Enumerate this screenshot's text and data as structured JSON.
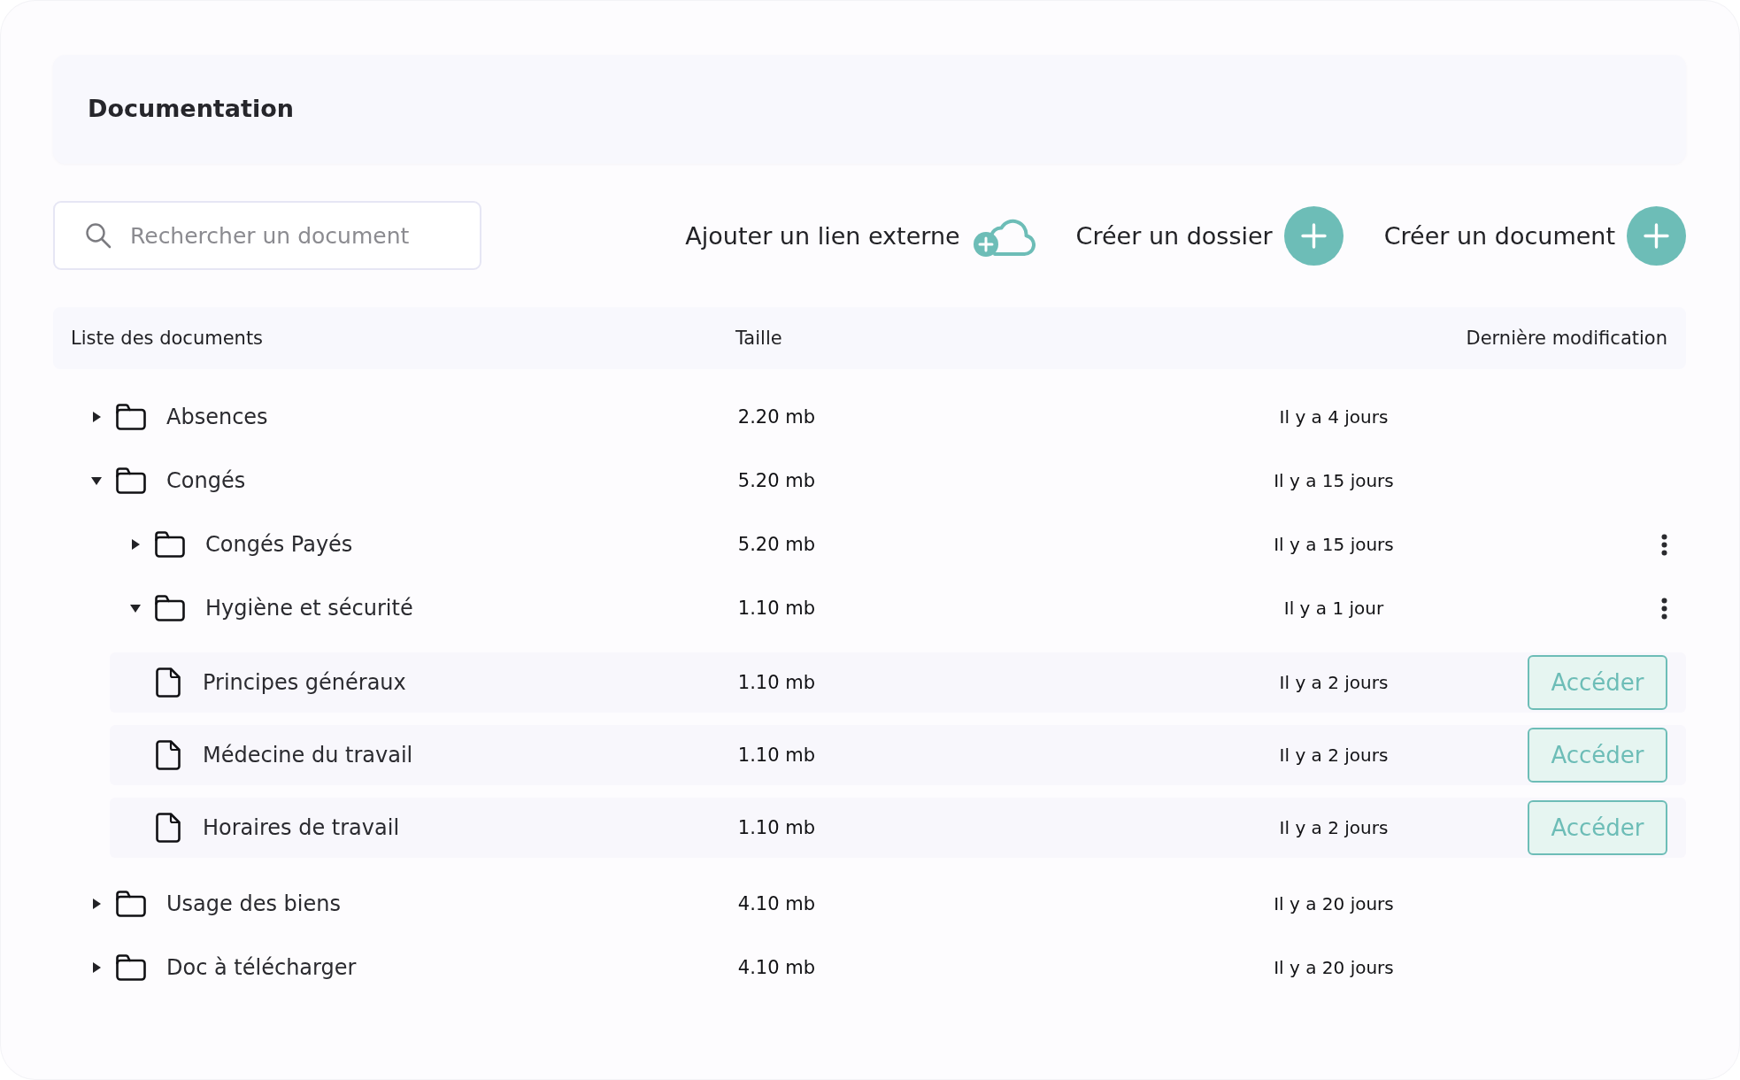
{
  "header": {
    "title": "Documentation"
  },
  "toolbar": {
    "search": {
      "placeholder": "Rechercher un document"
    },
    "actions": [
      {
        "label": "Ajouter un lien externe",
        "kind": "cloud"
      },
      {
        "label": "Créer un dossier",
        "kind": "plus"
      },
      {
        "label": "Créer un document",
        "kind": "plus"
      }
    ]
  },
  "table": {
    "columns": [
      "Liste des documents",
      "Taille",
      "Dernière modification"
    ],
    "rows": [
      {
        "kind": "folder",
        "name": "Absences",
        "size": "2.20 mb",
        "modified": "Il y a 4 jours",
        "expanded": false,
        "menu": false
      },
      {
        "kind": "folder",
        "name": "Congés",
        "size": "5.20 mb",
        "modified": "Il y a 15 jours",
        "expanded": true,
        "menu": false,
        "children": [
          {
            "kind": "folder",
            "name": "Congés Payés",
            "size": "5.20 mb",
            "modified": "Il y a 15 jours",
            "expanded": false,
            "menu": true
          },
          {
            "kind": "folder",
            "name": "Hygiène et sécurité",
            "size": "1.10 mb",
            "modified": "Il y a 1 jour",
            "expanded": true,
            "menu": true,
            "children": [
              {
                "kind": "file",
                "name": "Principes généraux",
                "size": "1.10 mb",
                "modified": "Il y a 2 jours",
                "button": "Accéder"
              },
              {
                "kind": "file",
                "name": "Médecine du travail",
                "size": "1.10 mb",
                "modified": "Il y a 2 jours",
                "button": "Accéder"
              },
              {
                "kind": "file",
                "name": "Horaires de travail",
                "size": "1.10 mb",
                "modified": "Il y a 2 jours",
                "button": "Accéder"
              }
            ]
          }
        ]
      },
      {
        "kind": "folder",
        "name": "Usage des biens",
        "size": "4.10 mb",
        "modified": "Il y a 20 jours",
        "expanded": false,
        "menu": false
      },
      {
        "kind": "folder",
        "name": "Doc à télécharger",
        "size": "4.10 mb",
        "modified": "Il y a 20 jours",
        "expanded": false,
        "menu": false
      }
    ]
  }
}
